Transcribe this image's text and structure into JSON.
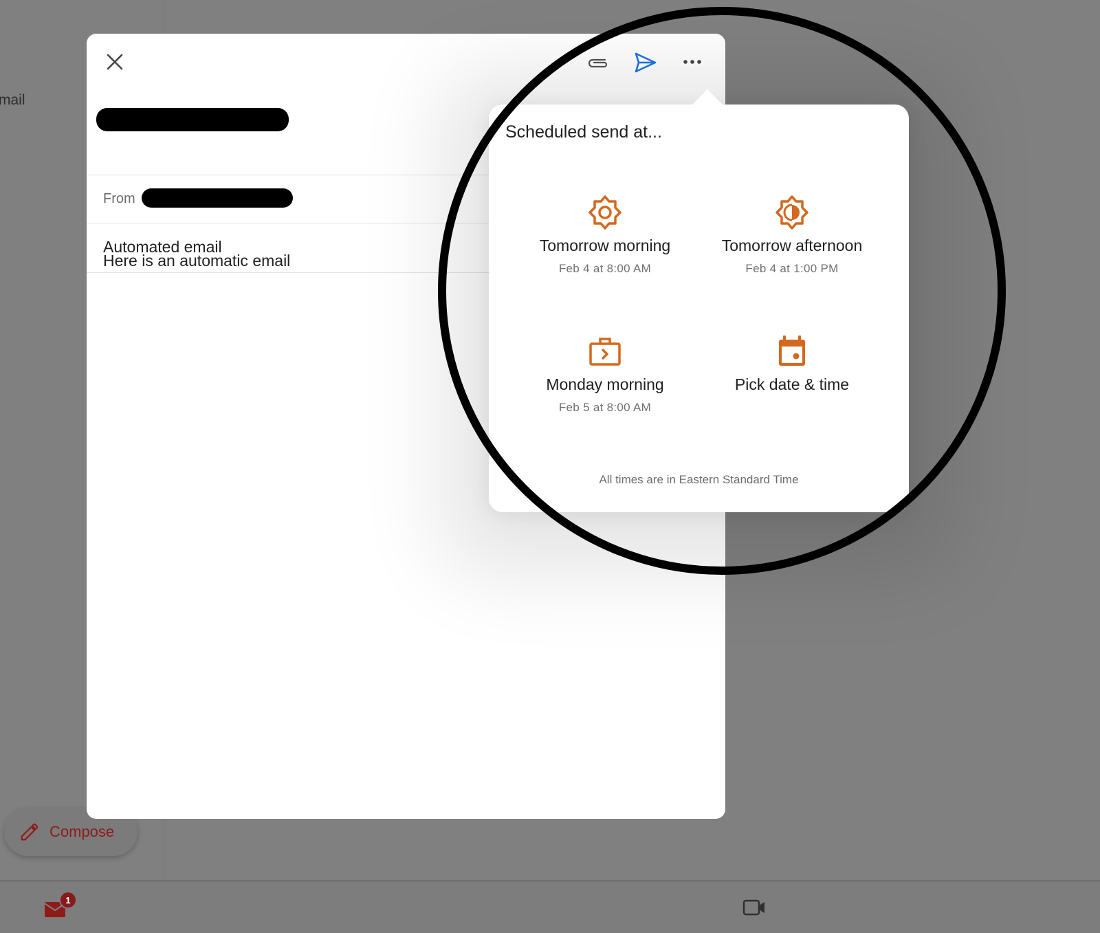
{
  "background": {
    "partial_text": "mail"
  },
  "compose": {
    "fab_label": "Compose",
    "icon": "pencil-icon"
  },
  "bottom_nav": {
    "mail_icon": "mail-icon",
    "mail_badge": "1",
    "meet_icon": "video-camera-icon"
  },
  "compose_sheet": {
    "close_icon": "close-icon",
    "attach_icon": "paperclip-icon",
    "send_icon": "send-icon",
    "more_icon": "more-horizontal-icon",
    "from_label": "From",
    "subject": "Automated email",
    "body": "Here is an automatic email"
  },
  "schedule_popover": {
    "title": "Scheduled send at...",
    "options": [
      {
        "label": "Tomorrow morning",
        "sub": "Feb 4 at 8:00 AM",
        "icon": "sun-icon"
      },
      {
        "label": "Tomorrow afternoon",
        "sub": "Feb 4 at 1:00 PM",
        "icon": "brightness-half-icon"
      },
      {
        "label": "Monday morning",
        "sub": "Feb 5 at 8:00 AM",
        "icon": "briefcase-icon"
      },
      {
        "label": "Pick date & time",
        "sub": "",
        "icon": "calendar-icon"
      }
    ],
    "footer": "All times are in Eastern Standard Time"
  },
  "colors": {
    "accent_orange": "#d2691e",
    "send_blue": "#1a73e8",
    "brand_red": "#8f1a1a",
    "backdrop": "#808080"
  }
}
